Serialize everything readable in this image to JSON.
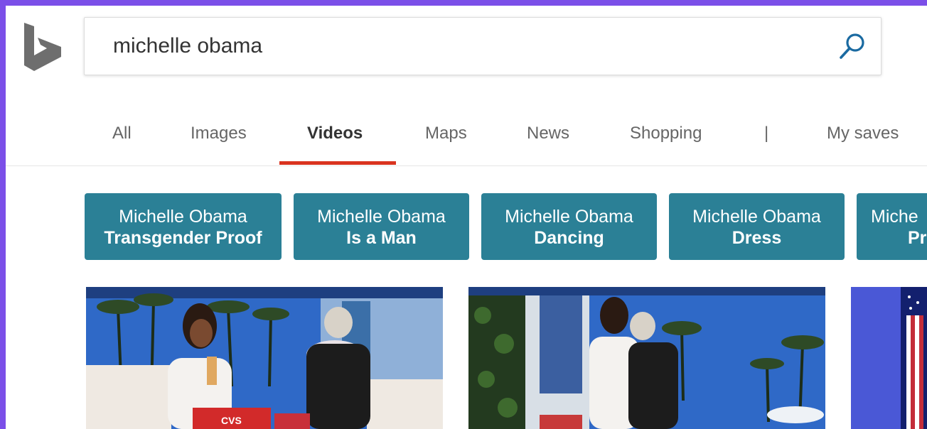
{
  "search": {
    "query": "michelle obama"
  },
  "tabs": [
    {
      "label": "All"
    },
    {
      "label": "Images"
    },
    {
      "label": "Videos"
    },
    {
      "label": "Maps"
    },
    {
      "label": "News"
    },
    {
      "label": "Shopping"
    },
    {
      "label": "|"
    },
    {
      "label": "My saves"
    }
  ],
  "related_searches": [
    {
      "line1": "Michelle Obama",
      "line2": "Transgender Proof"
    },
    {
      "line1": "Michelle Obama",
      "line2": "Is a Man"
    },
    {
      "line1": "Michelle Obama",
      "line2": "Dancing"
    },
    {
      "line1": "Michelle Obama",
      "line2": "Dress"
    },
    {
      "line1": "Miche",
      "line2": "Pr"
    }
  ],
  "videos": [
    {
      "overlay_text": "CVS"
    },
    {
      "overlay_text": ""
    },
    {
      "overlay_text": ""
    }
  ],
  "colors": {
    "accent_underline": "#d9331f",
    "chip_bg": "#2b8096",
    "frame_border": "#7b4fe8",
    "search_icon": "#1a6aa1"
  },
  "icons": {
    "logo": "bing-logo",
    "search": "magnifier-icon"
  }
}
